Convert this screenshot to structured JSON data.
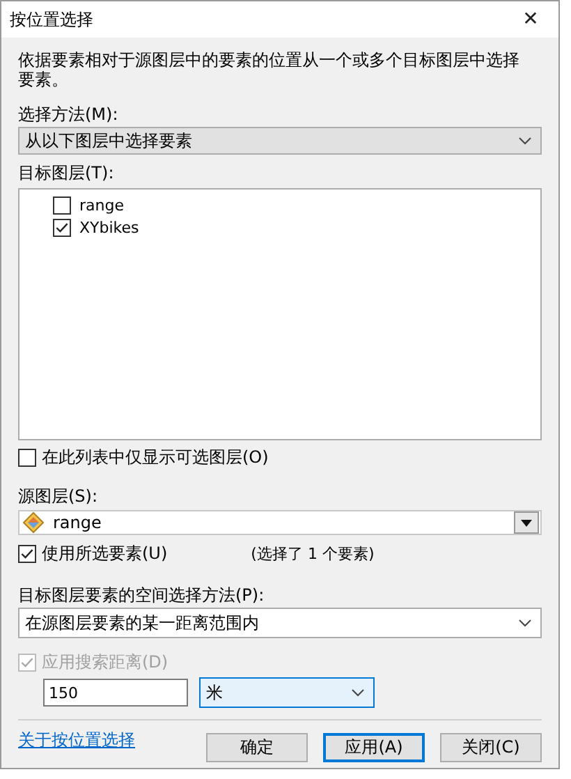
{
  "window": {
    "title": "按位置选择",
    "close": "✕"
  },
  "description": "依据要素相对于源图层中的要素的位置从一个或多个目标图层中选择要素。",
  "selection_method": {
    "label": "选择方法(M):",
    "value": "从以下图层中选择要素"
  },
  "target_layers": {
    "label": "目标图层(T):",
    "items": [
      {
        "label": "range",
        "checked": false
      },
      {
        "label": "XYbikes",
        "checked": true
      }
    ]
  },
  "only_selectable": {
    "label": "在此列表中仅显示可选图层(O)",
    "checked": false
  },
  "source_layer": {
    "label": "源图层(S):",
    "value": "range"
  },
  "use_selected": {
    "label": "使用所选要素(U)",
    "checked": true
  },
  "selected_count": "(选择了 1 个要素)",
  "spatial_method": {
    "label": "目标图层要素的空间选择方法(P):",
    "value": "在源图层要素的某一距离范围内"
  },
  "search_distance": {
    "label": "应用搜索距离(D)",
    "checked": true,
    "disabled": true,
    "value": "150",
    "unit": "米"
  },
  "link": "关于按位置选择",
  "buttons": [
    {
      "label": "确定",
      "focused": false
    },
    {
      "label": "应用(A)",
      "focused": true
    },
    {
      "label": "关闭(C)",
      "focused": false
    }
  ]
}
